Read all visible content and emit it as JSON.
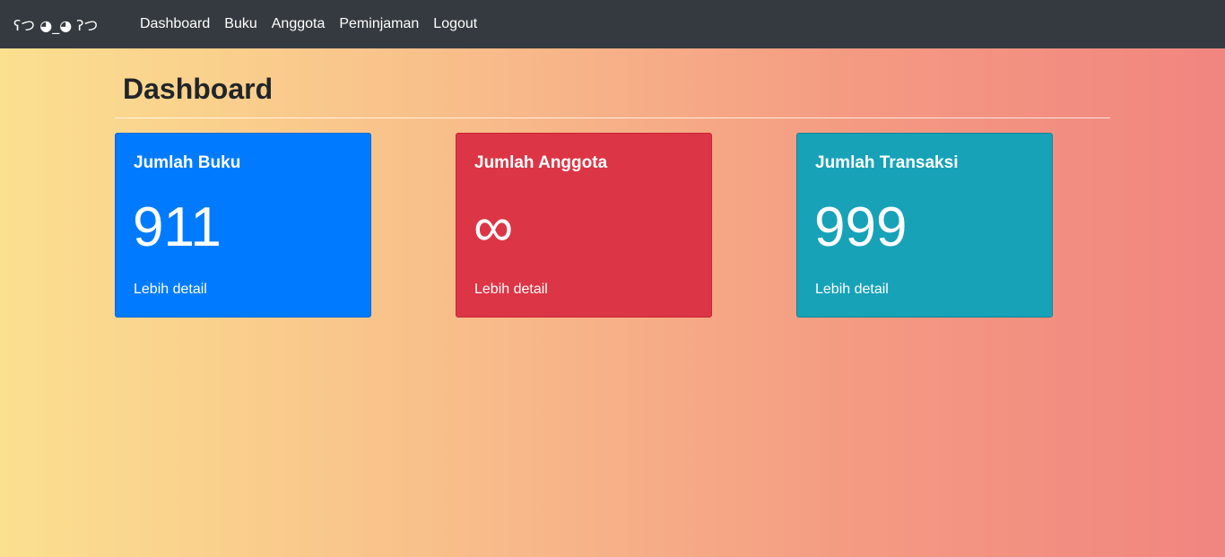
{
  "navbar": {
    "brand": "ʕつ ◕_◕ ʔつ",
    "items": [
      {
        "label": "Dashboard"
      },
      {
        "label": "Buku"
      },
      {
        "label": "Anggota"
      },
      {
        "label": "Peminjaman"
      },
      {
        "label": "Logout"
      }
    ]
  },
  "page": {
    "title": "Dashboard"
  },
  "cards": [
    {
      "title": "Jumlah Buku",
      "value": "911",
      "link": "Lebih detail",
      "color": "#007bff"
    },
    {
      "title": "Jumlah Anggota",
      "value": "∞",
      "link": "Lebih detail",
      "color": "#dc3545"
    },
    {
      "title": "Jumlah Transaksi",
      "value": "999",
      "link": "Lebih detail",
      "color": "#17a2b8"
    }
  ]
}
